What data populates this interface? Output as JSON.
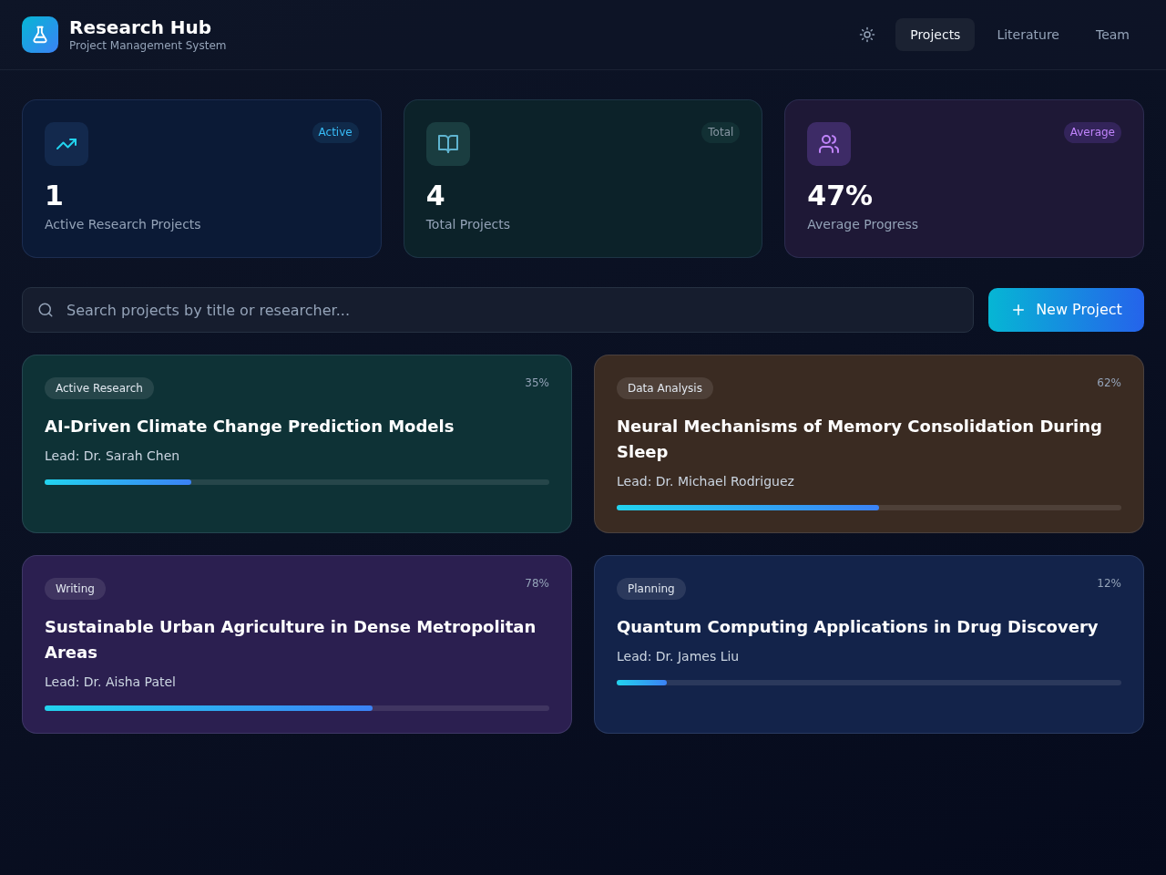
{
  "header": {
    "title": "Research Hub",
    "subtitle": "Project Management System"
  },
  "nav": [
    {
      "label": "Projects",
      "selected": true
    },
    {
      "label": "Literature",
      "selected": false
    },
    {
      "label": "Team",
      "selected": false
    }
  ],
  "stats": [
    {
      "kind": "trend",
      "badge": "Active",
      "value": "1",
      "label": "Active Research Projects",
      "color": "#0b1a36"
    },
    {
      "kind": "book",
      "badge": "Total",
      "value": "4",
      "label": "Total Projects",
      "color": "#0c2229"
    },
    {
      "kind": "users",
      "badge": "Average",
      "value": "47%",
      "label": "Average Progress",
      "color": "#1e1836"
    }
  ],
  "search": {
    "placeholder": "Search projects by title or researcher..."
  },
  "new_button": {
    "label": "New Project"
  },
  "projects": [
    {
      "status": "Active Research",
      "percent": "35%",
      "title": "AI-Driven Climate Change Prediction Models",
      "lead": "Lead: Dr. Sarah Chen",
      "level": 0.29,
      "color": "#0e3236"
    },
    {
      "status": "Data Analysis",
      "percent": "62%",
      "title": "Neural Mechanisms of Memory Consolidation During Sleep",
      "lead": "Lead: Dr. Michael Rodriguez",
      "level": 0.52,
      "color": "#3a2b22"
    },
    {
      "status": "Writing",
      "percent": "78%",
      "title": "Sustainable Urban Agriculture in Dense Metropolitan Areas",
      "lead": "Lead: Dr. Aisha Patel",
      "level": 0.65,
      "color": "#2b1f50"
    },
    {
      "status": "Planning",
      "percent": "12%",
      "title": "Quantum Computing Applications in Drug Discovery",
      "lead": "Lead: Dr. James Liu",
      "level": 0.1,
      "color": "#13234a"
    }
  ]
}
